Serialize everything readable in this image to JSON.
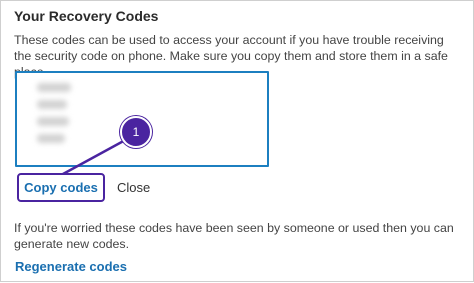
{
  "panel": {
    "title": "Your Recovery Codes",
    "description": "These codes can be used to access your account if you have trouble receiving the security code on phone. Make sure you copy them and store them in a safe place."
  },
  "codes": {
    "state": "blurred",
    "line_count": 4
  },
  "annotation": {
    "badge_number": "1",
    "color": "#4a24a0"
  },
  "actions": {
    "copy_label": "Copy codes",
    "close_label": "Close"
  },
  "regenerate": {
    "note": "If you're worried these codes have been seen by someone or used then you can generate new codes.",
    "link_label": "Regenerate codes"
  },
  "colors": {
    "link": "#1a6fb0",
    "box_border": "#1c7fc0",
    "highlight": "#4a24a0"
  }
}
